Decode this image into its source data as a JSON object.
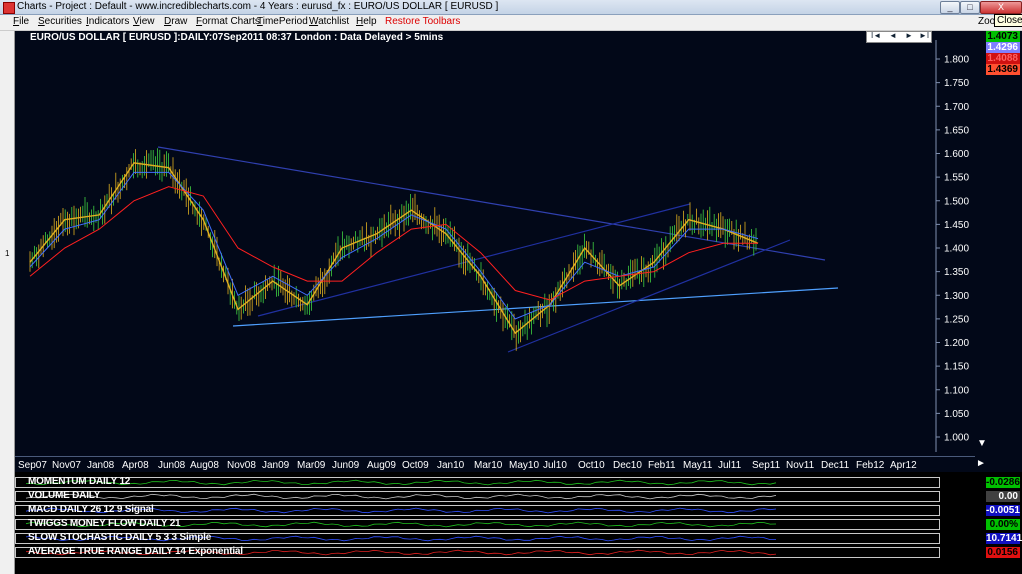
{
  "window": {
    "title": "Charts - Project : Default - www.incrediblecharts.com - 4 Years  : eurusd_fx : EURO/US DOLLAR  [ EURUSD ]",
    "minimize": "_",
    "restore": "□",
    "close": "X",
    "tooltip": "Close",
    "zoom": "Zoo"
  },
  "menu": {
    "items": [
      "File",
      "Securities",
      "Indicators",
      "View",
      "Draw",
      "Format Charts",
      "TimePeriod",
      "Watchlist",
      "Help"
    ],
    "restore_toolbars": "Restore Toolbars"
  },
  "left_panel_number": "1",
  "chart": {
    "heading": "EURO/US DOLLAR [ EURUSD ]:DAILY:07Sep2011 08:37 London : Data Delayed > 5mins",
    "nav_buttons": [
      "I◄",
      "◄",
      "►",
      "►I"
    ],
    "price_boxes": [
      {
        "value": "1.4073",
        "bg": "#00c000",
        "fg": "#000000"
      },
      {
        "value": "1.4296",
        "bg": "#8080ff",
        "fg": "#ffffff"
      },
      {
        "value": "1.4088",
        "bg": "#d01010",
        "fg": "#ff6060"
      },
      {
        "value": "1.4369",
        "bg": "#ff5030",
        "fg": "#000000"
      }
    ]
  },
  "chart_data": {
    "type": "line",
    "title": "EURO/US DOLLAR [ EURUSD ]:DAILY:07Sep2011 08:37 London : Data Delayed > 5mins",
    "x": [
      "Sep07",
      "Nov07",
      "Jan08",
      "Apr08",
      "Jun08",
      "Aug08",
      "Nov08",
      "Jan09",
      "Mar09",
      "Jun09",
      "Aug09",
      "Oct09",
      "Jan10",
      "Mar10",
      "May10",
      "Jul10",
      "Oct10",
      "Dec10",
      "Feb11",
      "May11",
      "Jul11",
      "Sep11",
      "Nov11",
      "Dec11",
      "Feb12",
      "Apr12"
    ],
    "y_ticks": [
      "1.800",
      "1.750",
      "1.700",
      "1.650",
      "1.600",
      "1.550",
      "1.500",
      "1.450",
      "1.400",
      "1.350",
      "1.300",
      "1.250",
      "1.200",
      "1.150",
      "1.100",
      "1.050",
      "1.000"
    ],
    "ylim": [
      1.0,
      1.8
    ],
    "series": [
      {
        "values": [
          1.37,
          1.46,
          1.47,
          1.58,
          1.57,
          1.46,
          1.27,
          1.33,
          1.28,
          1.4,
          1.43,
          1.48,
          1.43,
          1.34,
          1.22,
          1.28,
          1.4,
          1.32,
          1.37,
          1.46,
          1.44,
          1.41
        ],
        "color": "#e0b020"
      },
      {
        "values": [
          1.36,
          1.44,
          1.46,
          1.56,
          1.56,
          1.48,
          1.3,
          1.34,
          1.3,
          1.38,
          1.42,
          1.47,
          1.44,
          1.35,
          1.25,
          1.28,
          1.37,
          1.34,
          1.36,
          1.44,
          1.44,
          1.42
        ],
        "color": "#4070ff"
      },
      {
        "values": [
          1.34,
          1.4,
          1.44,
          1.5,
          1.53,
          1.51,
          1.4,
          1.36,
          1.33,
          1.33,
          1.39,
          1.44,
          1.45,
          1.39,
          1.31,
          1.29,
          1.33,
          1.34,
          1.35,
          1.39,
          1.41,
          1.41
        ],
        "color": "#ff2020"
      }
    ],
    "grid": false
  },
  "indicators": [
    {
      "label": "MOMENTUM DAILY 12",
      "value": "-0.0286",
      "bg": "#00c000",
      "fg": "#000000",
      "line": "#20c020"
    },
    {
      "label": "VOLUME DAILY",
      "value": "0.00",
      "bg": "#404040",
      "fg": "#ffffff",
      "line": "#c8c8c8"
    },
    {
      "label": "MACD DAILY 26 12 9 Signal",
      "value": "-0.0051",
      "bg": "#1010c0",
      "fg": "#ffffff",
      "line": "#3050ff"
    },
    {
      "label": "TWIGGS MONEY FLOW DAILY 21",
      "value": "0.00%",
      "bg": "#00c000",
      "fg": "#000000",
      "line": "#20c020"
    },
    {
      "label": "SLOW STOCHASTIC DAILY 5 3 3 Simple",
      "value": "10.7141",
      "bg": "#1010c0",
      "fg": "#ffffff",
      "line": "#3050ff"
    },
    {
      "label": "AVERAGE TRUE RANGE DAILY 14 Exponential",
      "value": "0.0156",
      "bg": "#e01010",
      "fg": "#000000",
      "line": "#e02020"
    }
  ]
}
